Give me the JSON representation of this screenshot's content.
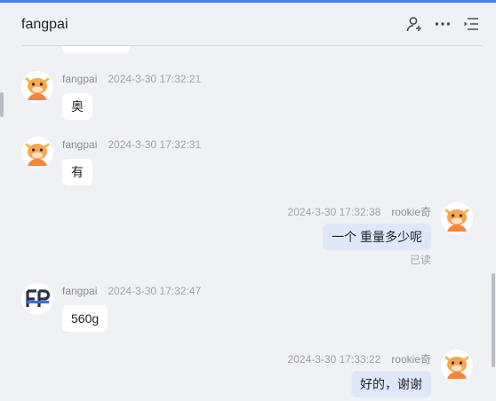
{
  "header": {
    "title": "fangpai",
    "icons": [
      "person-add-icon",
      "more-icon",
      "list-icon"
    ]
  },
  "messages": [
    {
      "side": "left",
      "avatar": "cow-avatar",
      "name": "fangpai",
      "time": "2024-3-30 17:32:21",
      "text": "奥"
    },
    {
      "side": "left",
      "avatar": "cow-avatar",
      "name": "fangpai",
      "time": "2024-3-30 17:32:31",
      "text": "有"
    },
    {
      "side": "right",
      "avatar": "cow-avatar",
      "name": "rookie奇",
      "time": "2024-3-30 17:32:38",
      "text": "一个 重量多少呢",
      "status": "已读"
    },
    {
      "side": "left",
      "avatar": "fp-logo-avatar",
      "name": "fangpai",
      "time": "2024-3-30 17:32:47",
      "text": "560g"
    },
    {
      "side": "right",
      "avatar": "cow-avatar",
      "name": "rookie奇",
      "time": "2024-3-30 17:33:22",
      "text": "好的，谢谢"
    }
  ],
  "colors": {
    "accent": "#3b82f6",
    "background": "#f0f1f5",
    "out_bubble": "#dfe8fb",
    "in_bubble": "#ffffff",
    "avatar_orange": "#f5843e"
  }
}
